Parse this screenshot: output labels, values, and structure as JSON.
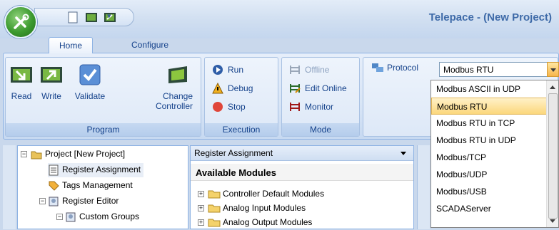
{
  "window": {
    "title": "Telepace - (New Project)"
  },
  "tabs": [
    {
      "label": "Home"
    },
    {
      "label": "Configure"
    }
  ],
  "ribbon": {
    "program": {
      "label": "Program",
      "buttons": [
        {
          "label": "Read"
        },
        {
          "label": "Write"
        },
        {
          "label": "Validate"
        },
        {
          "label": "Change",
          "label2": "Controller"
        }
      ]
    },
    "execution": {
      "label": "Execution",
      "buttons": [
        {
          "label": "Run"
        },
        {
          "label": "Debug"
        },
        {
          "label": "Stop"
        }
      ]
    },
    "mode": {
      "label": "Mode",
      "buttons": [
        {
          "label": "Offline",
          "disabled": true
        },
        {
          "label": "Edit Online"
        },
        {
          "label": "Monitor"
        }
      ]
    },
    "protocol": {
      "label": "Protocol",
      "selected": "Modbus RTU",
      "options": [
        "Modbus ASCII in UDP",
        "Modbus RTU",
        "Modbus RTU in TCP",
        "Modbus RTU in UDP",
        "Modbus/TCP",
        "Modbus/UDP",
        "Modbus/USB",
        "SCADAServer"
      ]
    }
  },
  "project_tree": [
    {
      "label": "Project [New Project]"
    },
    {
      "label": "Register Assignment"
    },
    {
      "label": "Tags Management"
    },
    {
      "label": "Register Editor"
    },
    {
      "label": "Custom Groups"
    }
  ],
  "register_panel": {
    "title": "Register Assignment",
    "subtitle": "Available Modules",
    "modules": [
      "Controller Default Modules",
      "Analog Input Modules",
      "Analog Output Modules"
    ]
  },
  "colors": {
    "accent": "#15428b",
    "selection": "#fbd77c",
    "ribbon_border": "#8db2e3"
  }
}
